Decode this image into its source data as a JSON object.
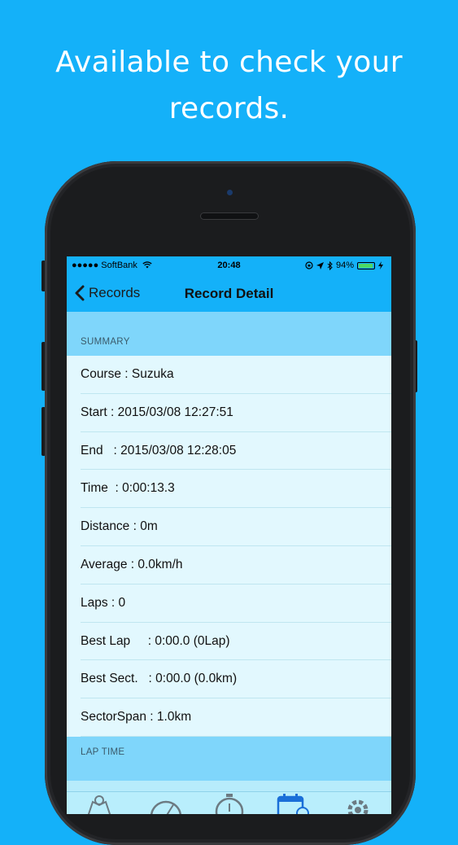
{
  "headline": {
    "line1": "Available to check your",
    "line2": "records."
  },
  "status_bar": {
    "carrier": "●●●●● SoftBank",
    "time": "20:48",
    "battery": "94%"
  },
  "nav": {
    "back_label": "Records",
    "title": "Record Detail"
  },
  "summary": {
    "header": "SUMMARY",
    "rows": [
      "Course : Suzuka",
      "Start : 2015/03/08 12:27:51",
      "End   : 2015/03/08 12:28:05",
      "Time  : 0:00:13.3",
      "Distance : 0m",
      "Average : 0.0km/h",
      "Laps : 0",
      "Best Lap     : 0:00.0 (0Lap)",
      "Best Sect.   : 0:00.0 (0.0km)",
      "SectorSpan : 1.0km"
    ]
  },
  "lap_time": {
    "header": "LAP TIME"
  },
  "colors": {
    "background": "#14b1f9",
    "section_header": "#7fd6fb",
    "row_bg": "#e2f8fe",
    "tab_active": "#1a6fd8"
  },
  "tabs": [
    "map-icon",
    "speedometer-icon",
    "stopwatch-icon",
    "calendar-icon",
    "gear-icon"
  ]
}
